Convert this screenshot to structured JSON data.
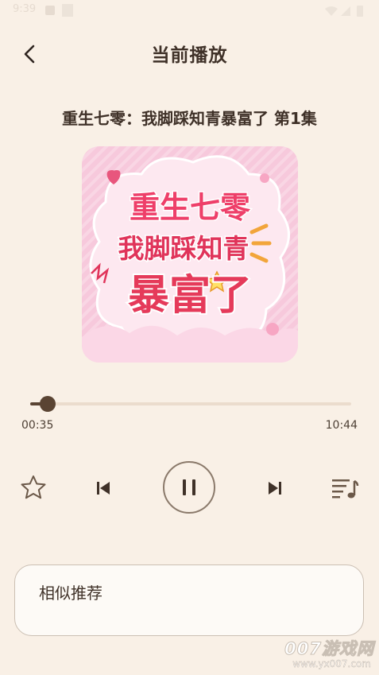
{
  "status_bar": {
    "time": "9:39",
    "icons": [
      "notification-icon",
      "blank-icon",
      "wifi-icon",
      "signal-icon",
      "battery-icon"
    ]
  },
  "header": {
    "back_icon": "chevron-left-icon",
    "title": "当前播放"
  },
  "track": {
    "title": "重生七零：我脚踩知青暴富了 第1集",
    "cover": {
      "line1": "重生七零",
      "line2": "我脚踩知青",
      "line3": "暴富了"
    }
  },
  "progress": {
    "current": "00:35",
    "total": "10:44",
    "fraction": 0.054
  },
  "controls": {
    "favorite_icon": "star-outline-icon",
    "previous_icon": "skip-previous-icon",
    "play_state_icon": "pause-icon",
    "next_icon": "skip-next-icon",
    "playlist_icon": "playlist-music-icon"
  },
  "recommend": {
    "title": "相似推荐"
  },
  "watermark": {
    "line1": "007游戏网",
    "line2": "www.yx007.com"
  },
  "colors": {
    "background": "#f9f0e6",
    "accent": "#5a4433",
    "track": "#ebdccd",
    "text": "#3f3128",
    "cover_pink": "#f6c6da",
    "cover_red": "#e0345a"
  }
}
